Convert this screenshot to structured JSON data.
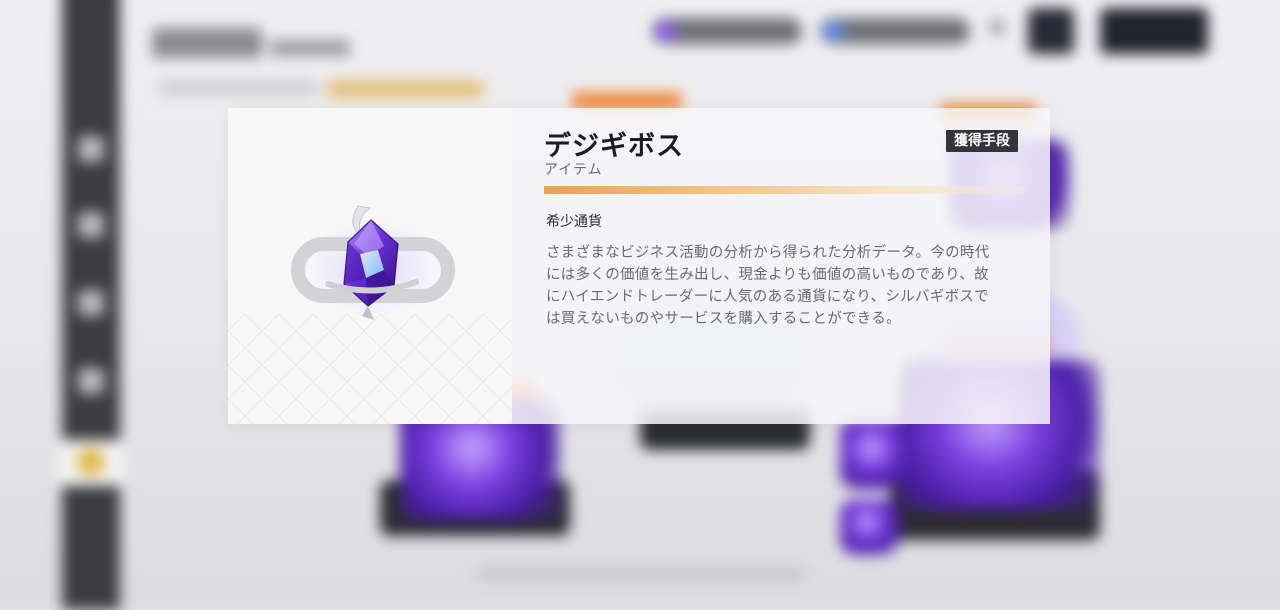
{
  "item_dialog": {
    "name": "デジギボス",
    "type": "アイテム",
    "acquire_button_label": "獲得手段",
    "category": "希少通貨",
    "description_lines": [
      "さまざまなビジネス活動の分析から得られた分析データ。今の時代",
      "には多くの価値を生み出し、現金よりも価値の高いものであり、故",
      "にハイエンドトレーダーに人気のある通貨になり、シルバギボスで",
      "は買えないものやサービスを購入することができる。"
    ],
    "icon": "purple-crystal-icon"
  },
  "colors": {
    "rarity_bar": "#e9a44a",
    "button_bg": "#34343c",
    "crystal": "#6a2fd6"
  }
}
